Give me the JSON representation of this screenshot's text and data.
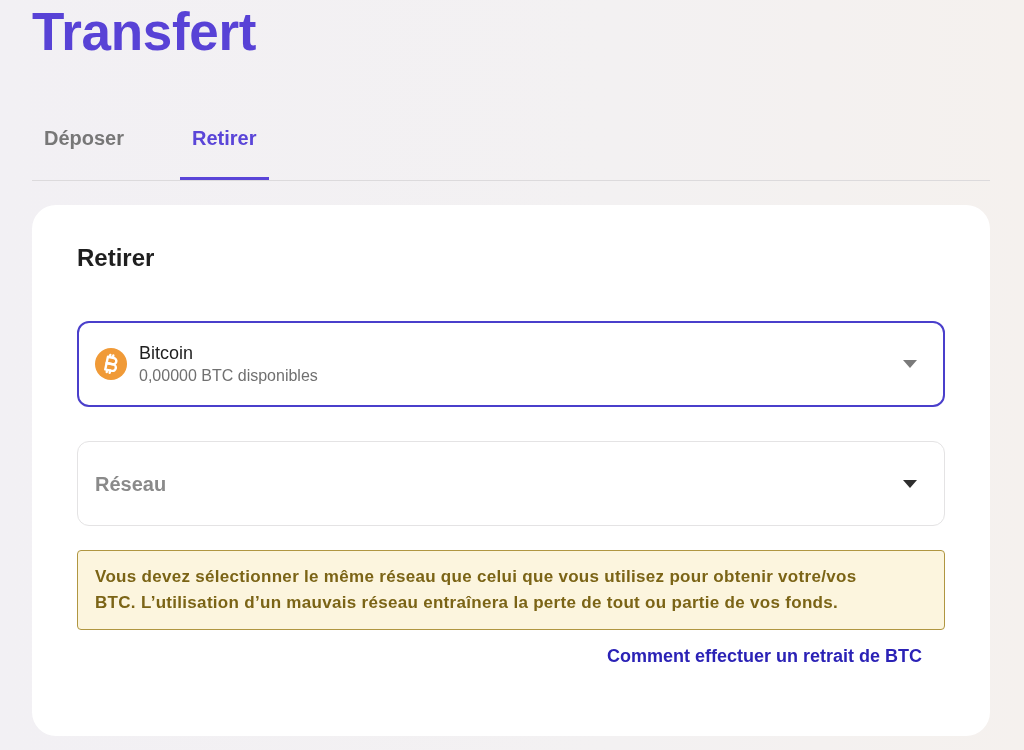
{
  "page": {
    "title": "Transfert"
  },
  "tabs": [
    {
      "label": "Déposer",
      "selected": false
    },
    {
      "label": "Retirer",
      "selected": true
    }
  ],
  "card": {
    "heading": "Retirer",
    "selects": [
      {
        "kind": "asset",
        "name": "Bitcoin",
        "balance": "0,00000 BTC disponibles",
        "focused": true
      },
      {
        "kind": "network",
        "placeholder": "Réseau",
        "focused": false
      }
    ],
    "warning": "Vous devez sélectionner le même réseau que celui que vous utilisez pour obtenir votre/vos BTC. L’utilisation d’un mauvais réseau entraînera la perte de tout ou partie de vos fonds.",
    "help_link": "Comment effectuer un retrait de BTC"
  }
}
